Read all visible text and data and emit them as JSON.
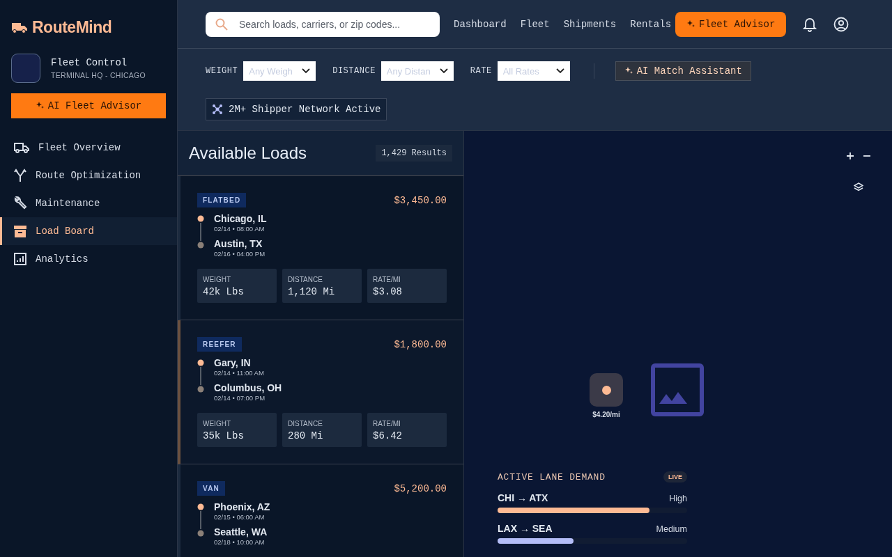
{
  "brand": {
    "name": "RouteMind"
  },
  "workspace": {
    "title": "Fleet Control",
    "subtitle": "TERMINAL HQ - CHICAGO"
  },
  "advisor_button": {
    "label": "AI Fleet Advisor"
  },
  "sidebar": {
    "items": [
      {
        "label": "Fleet Overview",
        "selected": false
      },
      {
        "label": "Route Optimization",
        "selected": false
      },
      {
        "label": "Maintenance",
        "selected": false
      },
      {
        "label": "Load Board",
        "selected": true
      },
      {
        "label": "Analytics",
        "selected": false
      }
    ]
  },
  "search": {
    "placeholder": "Search loads, carriers, or zip codes..."
  },
  "top_nav": [
    "Dashboard",
    "Fleet",
    "Shipments",
    "Rentals"
  ],
  "top_button": {
    "label": "Fleet Advisor"
  },
  "filters": [
    {
      "label": "WEIGHT",
      "placeholder": "Any Weigh"
    },
    {
      "label": "DISTANCE",
      "placeholder": "Any Distan"
    },
    {
      "label": "RATE",
      "placeholder": "All Rates"
    }
  ],
  "match_button": {
    "label": "AI Match Assistant"
  },
  "network_badge": {
    "label": "2M+ Shipper Network Active"
  },
  "loads": {
    "title": "Available Loads",
    "count": "1,429 Results",
    "items": [
      {
        "type": "FLATBED",
        "price": "$3,450.00",
        "selected": false,
        "origin": "Chicago, IL",
        "origin_time": "02/14 • 08:00 AM",
        "destination": "Austin, TX",
        "destination_time": "02/16 • 04:00 PM",
        "stats": [
          {
            "label": "WEIGHT",
            "value": "42k Lbs"
          },
          {
            "label": "DISTANCE",
            "value": "1,120 Mi"
          },
          {
            "label": "RATE/MI",
            "value": "$3.08"
          }
        ]
      },
      {
        "type": "REEFER",
        "price": "$1,800.00",
        "selected": true,
        "origin": "Gary, IN",
        "origin_time": "02/14 • 11:00 AM",
        "destination": "Columbus, OH",
        "destination_time": "02/14 • 07:00 PM",
        "stats": [
          {
            "label": "WEIGHT",
            "value": "35k Lbs"
          },
          {
            "label": "DISTANCE",
            "value": "280 Mi"
          },
          {
            "label": "RATE/MI",
            "value": "$6.42"
          }
        ]
      },
      {
        "type": "VAN",
        "price": "$5,200.00",
        "selected": false,
        "origin": "Phoenix, AZ",
        "origin_time": "02/15 • 06:00 AM",
        "destination": "Seattle, WA",
        "destination_time": "02/18 • 10:00 AM"
      }
    ]
  },
  "map": {
    "marker_label": "$4.20/mi"
  },
  "lane_demand": {
    "title": "ACTIVE LANE DEMAND",
    "badge": "LIVE",
    "lanes": [
      {
        "route": "CHI → ATX",
        "demand": "High",
        "level": 0.8,
        "color": "#fdba94"
      },
      {
        "route": "LAX → SEA",
        "demand": "Medium",
        "level": 0.4,
        "color": "#b4bdf8"
      }
    ]
  }
}
